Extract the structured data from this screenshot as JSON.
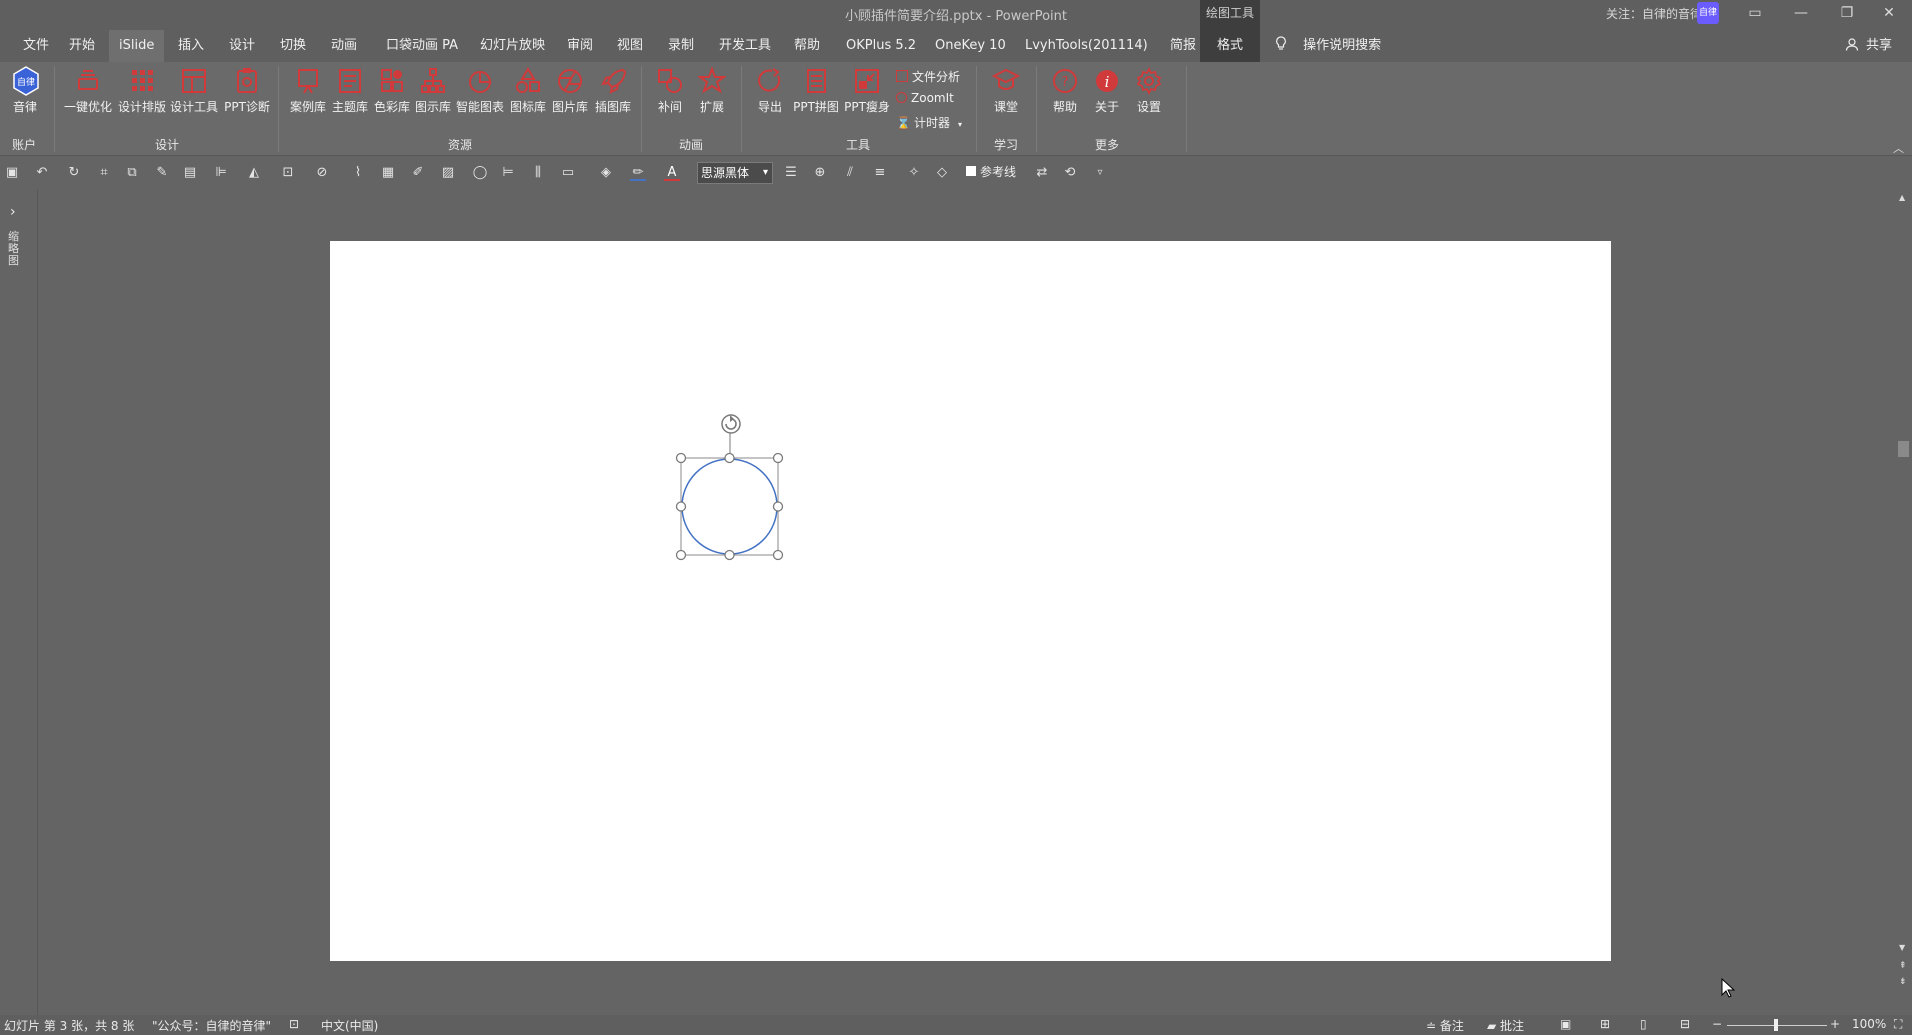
{
  "window": {
    "title": "小顾插件简要介绍.pptx  -  PowerPoint",
    "contextual_group": "绘图工具",
    "follow_text": "关注：自律的音律",
    "avatar_text": "自律",
    "minimize": "—",
    "restore": "❐",
    "close": "✕",
    "ribbon_display": "▭"
  },
  "tabs": [
    "文件",
    "开始",
    "iSlide",
    "插入",
    "设计",
    "切换",
    "动画",
    "口袋动画 PA",
    "幻灯片放映",
    "审阅",
    "视图",
    "录制",
    "开发工具",
    "帮助",
    "OKPlus 5.2",
    "OneKey 10",
    "LvyhTools(201114)",
    "简报",
    "格式"
  ],
  "active_tab": "iSlide",
  "tell_me": "操作说明搜索",
  "share": "共享",
  "ribbon": {
    "groups": {
      "account": "账户",
      "design": "设计",
      "resources": "资源",
      "animation": "动画",
      "tools": "工具",
      "learn": "学习",
      "more": "更多"
    },
    "buttons": {
      "yinlv": "音律",
      "optimize": "一键优化",
      "layout": "设计排版",
      "design_tools": "设计工具",
      "diagnose": "PPT诊断",
      "cases": "案例库",
      "themes": "主题库",
      "colors": "色彩库",
      "diagrams": "图示库",
      "smart_charts": "智能图表",
      "icons": "图标库",
      "pictures": "图片库",
      "illustrations": "插图库",
      "tween": "补间",
      "extend": "扩展",
      "export": "导出",
      "ppt_merge": "PPT拼图",
      "ppt_slim": "PPT瘦身",
      "file_analysis": "文件分析",
      "zoomit": "ZoomIt",
      "timer": "计时器",
      "classroom": "课堂",
      "help": "帮助",
      "about": "关于",
      "settings": "设置"
    }
  },
  "qat": {
    "font_name": "思源黑体",
    "reference_line": "参考线"
  },
  "left_pane": {
    "thumbnails_label": "缩略图",
    "expand": "›"
  },
  "statusbar": {
    "slide_info": "幻灯片 第 3 张，共 8 张",
    "note_text": "\"公众号：自律的音律\"",
    "language": "中文(中国)",
    "notes": "备注",
    "comments": "批注",
    "zoom": "100%"
  },
  "colors": {
    "accent_red": "#d03a3a",
    "shape_outline": "#4472c4",
    "selection_handle": "#7a7a7a"
  }
}
